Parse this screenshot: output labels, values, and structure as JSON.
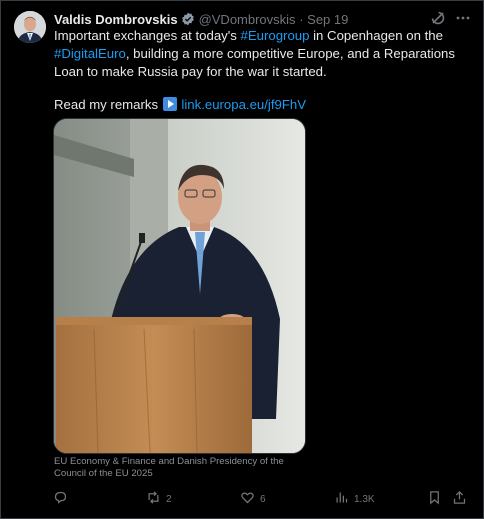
{
  "post": {
    "author_name": "Valdis Dombrovskis",
    "handle": "@VDombrovskis",
    "separator": "·",
    "date": "Sep 19",
    "text_parts": {
      "p1": "Important exchanges at today's ",
      "tag1": "#Eurogroup",
      "p2": " in Copenhagen on the ",
      "tag2": "#DigitalEuro",
      "p3": ", building a more competitive Europe, and a Reparations Loan to make Russia pay for the war it started."
    },
    "remarks_label": "Read my remarks",
    "remarks_link": "link.europa.eu/jf9FhV",
    "media_caption": "EU Economy & Finance and Danish Presidency of the Council of the EU 2025"
  },
  "actions": {
    "reply_count": "",
    "repost_count": "2",
    "like_count": "6",
    "views_count": "1.3K"
  },
  "icons": {
    "verified": "verified-badge-icon",
    "grok": "grok-icon",
    "more": "more-icon",
    "play": "play-button-emoji-icon",
    "reply": "reply-icon",
    "repost": "repost-icon",
    "like": "like-icon",
    "views": "views-icon",
    "bookmark": "bookmark-icon",
    "share": "share-icon"
  },
  "colors": {
    "background": "#000000",
    "text": "#e7e9ea",
    "muted": "#71767b",
    "link": "#1d9bf0"
  }
}
